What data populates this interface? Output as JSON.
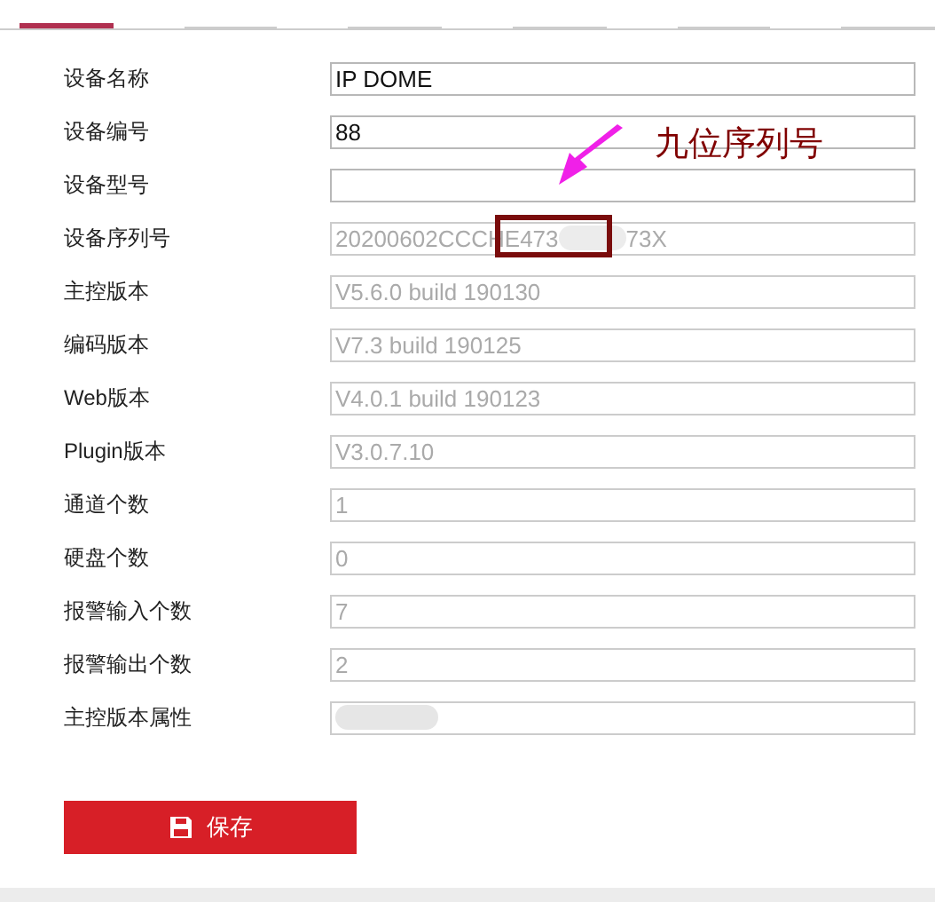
{
  "tabs": [
    {
      "selected": true
    },
    {
      "selected": false
    },
    {
      "selected": false
    },
    {
      "selected": false
    },
    {
      "selected": false
    },
    {
      "selected": false
    }
  ],
  "fields": [
    {
      "label": "设备名称",
      "value": "IP DOME",
      "disabled": false
    },
    {
      "label": "设备编号",
      "value": "88",
      "disabled": false
    },
    {
      "label": "设备型号",
      "disabled": false
    },
    {
      "label": "设备序列号",
      "value": "20200602CCCHE473",
      "value_end": "73X",
      "disabled": true,
      "blurred": true,
      "highlighted": true
    },
    {
      "label": "主控版本",
      "value": "V5.6.0 build 190130",
      "disabled": true
    },
    {
      "label": "编码版本",
      "value": "V7.3 build 190125",
      "disabled": true
    },
    {
      "label": "Web版本",
      "value": "V4.0.1 build 190123",
      "disabled": true
    },
    {
      "label": "Plugin版本",
      "value": "V3.0.7.10",
      "disabled": true
    },
    {
      "label": "通道个数",
      "value": "1",
      "disabled": true
    },
    {
      "label": "硬盘个数",
      "value": "0",
      "disabled": true
    },
    {
      "label": "报警输入个数",
      "value": "7",
      "disabled": true
    },
    {
      "label": "报警输出个数",
      "value": "2",
      "disabled": true
    },
    {
      "label": "主控版本属性",
      "disabled": true,
      "blurred": true
    }
  ],
  "annotation": {
    "text": "九位序列号"
  },
  "save_button": {
    "label": "保存"
  }
}
